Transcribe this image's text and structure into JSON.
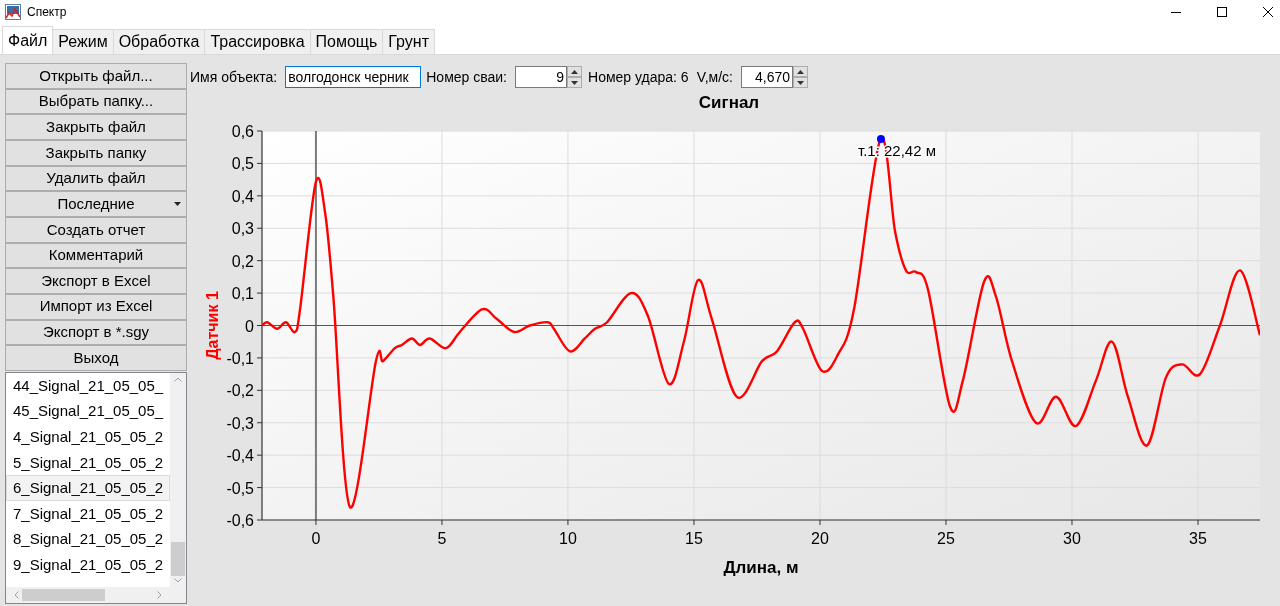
{
  "window": {
    "title": "Спектр"
  },
  "tabs": [
    {
      "label": "Файл",
      "selected": true
    },
    {
      "label": "Режим",
      "selected": false
    },
    {
      "label": "Обработка",
      "selected": false
    },
    {
      "label": "Трассировка",
      "selected": false
    },
    {
      "label": "Помощь",
      "selected": false
    },
    {
      "label": "Грунт",
      "selected": false
    }
  ],
  "sidebar": {
    "buttons": [
      {
        "kind": "button",
        "label": "Открыть файл..."
      },
      {
        "kind": "button",
        "label": "Выбрать папку..."
      },
      {
        "kind": "button",
        "label": "Закрыть файл"
      },
      {
        "kind": "button",
        "label": "Закрыть папку"
      },
      {
        "kind": "button",
        "label": "Удалить файл"
      },
      {
        "kind": "dropdown",
        "label": "Последние"
      },
      {
        "kind": "button",
        "label": "Создать отчет"
      },
      {
        "kind": "button",
        "label": "Комментарий"
      },
      {
        "kind": "button",
        "label": "Экспорт в Excel"
      },
      {
        "kind": "button",
        "label": "Импорт из Excel"
      },
      {
        "kind": "button",
        "label": "Экспорт в *.sgy"
      },
      {
        "kind": "button",
        "label": "Выход"
      }
    ]
  },
  "file_list": {
    "items": [
      {
        "label": "44_Signal_21_05_05_",
        "selected": false
      },
      {
        "label": "45_Signal_21_05_05_",
        "selected": false
      },
      {
        "label": "4_Signal_21_05_05_2",
        "selected": false
      },
      {
        "label": "5_Signal_21_05_05_2",
        "selected": false
      },
      {
        "label": "6_Signal_21_05_05_2",
        "selected": true
      },
      {
        "label": "7_Signal_21_05_05_2",
        "selected": false
      },
      {
        "label": "8_Signal_21_05_05_2",
        "selected": false
      },
      {
        "label": "9_Signal_21_05_05_2",
        "selected": false
      }
    ]
  },
  "toolbar": [
    {
      "kind": "label",
      "text": "Имя объекта:"
    },
    {
      "kind": "text_field",
      "value": "волгодонск черник",
      "focused": true
    },
    {
      "kind": "label",
      "text": "Номер сваи:"
    },
    {
      "kind": "spin",
      "value": "9",
      "focused": false
    },
    {
      "kind": "label",
      "text": "Номер удара: 6"
    },
    {
      "kind": "label",
      "text": "V,м/с:"
    },
    {
      "kind": "spin",
      "value": "4,670",
      "focused": false
    }
  ],
  "chart": {
    "chart_data": {
      "type": "line",
      "title": "Сигнал",
      "xlabel": "Длина, м",
      "ylabel": "Датчик 1",
      "grid": true,
      "x": [
        -2.14,
        -1.93,
        -1.54,
        -1.19,
        -0.83,
        -0.63,
        -0.01,
        0.36,
        0.69,
        1.35,
        2.38,
        2.66,
        3.13,
        3.41,
        3.81,
        4.13,
        4.52,
        5.16,
        5.71,
        6.59,
        7.18,
        7.86,
        8.49,
        9.2,
        9.44,
        10.08,
        10.67,
        11.07,
        11.55,
        12.5,
        13.17,
        14.0,
        14.6,
        15.16,
        15.71,
        16.7,
        17.7,
        18.29,
        19.0,
        19.33,
        20.08,
        20.71,
        21.35,
        22.4,
        22.98,
        23.41,
        23.81,
        24.29,
        25.16,
        25.67,
        26.51,
        26.98,
        27.62,
        28.57,
        29.37,
        30.16,
        30.95,
        31.59,
        32.22,
        32.98,
        33.73,
        34.37,
        35.08,
        35.87,
        36.67,
        37.46
      ],
      "series": [
        {
          "color": "#ff0000",
          "values": [
            0,
            0.01,
            -0.01,
            0.01,
            -0.02,
            0.05,
            0.44,
            0.35,
            0.09,
            -0.56,
            -0.11,
            -0.11,
            -0.07,
            -0.06,
            -0.04,
            -0.06,
            -0.04,
            -0.07,
            -0.02,
            0.05,
            0.02,
            -0.02,
            0,
            0.01,
            -0.01,
            -0.08,
            -0.04,
            -0.01,
            0.01,
            0.1,
            0.03,
            -0.18,
            -0.05,
            0.14,
            0.02,
            -0.22,
            -0.11,
            -0.08,
            0.01,
            -0.01,
            -0.14,
            -0.09,
            0.05,
            0.575,
            0.29,
            0.17,
            0.165,
            0.11,
            -0.25,
            -0.17,
            0.135,
            0.09,
            -0.11,
            -0.3,
            -0.22,
            -0.31,
            -0.17,
            -0.05,
            -0.22,
            -0.37,
            -0.16,
            -0.12,
            -0.15,
            0,
            0.17,
            -0.03
          ]
        }
      ],
      "xlim": [
        -2.14,
        37.46
      ],
      "ylim": [
        -0.6,
        0.6
      ],
      "xticks": [
        0,
        5,
        10,
        15,
        20,
        25,
        30,
        35
      ],
      "yticks": [
        {
          "value": -0.6,
          "label": "-0,6"
        },
        {
          "value": -0.5,
          "label": "-0,5"
        },
        {
          "value": -0.4,
          "label": "-0,4"
        },
        {
          "value": -0.3,
          "label": "-0,3"
        },
        {
          "value": -0.2,
          "label": "-0,2"
        },
        {
          "value": -0.1,
          "label": "-0,1"
        },
        {
          "value": 0,
          "label": "0"
        },
        {
          "value": 0.1,
          "label": "0,1"
        },
        {
          "value": 0.2,
          "label": "0,2"
        },
        {
          "value": 0.3,
          "label": "0,3"
        },
        {
          "value": 0.4,
          "label": "0,4"
        },
        {
          "value": 0.5,
          "label": "0,5"
        },
        {
          "value": 0.6,
          "label": "0,6"
        }
      ],
      "annotations": [
        {
          "x": 22.42,
          "y": 0.575,
          "text": "т.1: 22,42 м"
        }
      ]
    }
  }
}
